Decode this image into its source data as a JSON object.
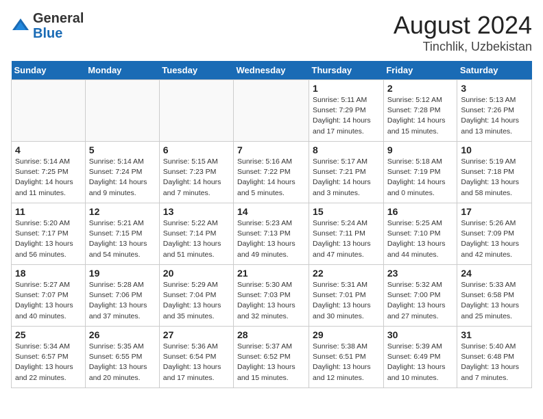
{
  "header": {
    "logo_general": "General",
    "logo_blue": "Blue",
    "month_year": "August 2024",
    "location": "Tinchlik, Uzbekistan"
  },
  "calendar": {
    "weekdays": [
      "Sunday",
      "Monday",
      "Tuesday",
      "Wednesday",
      "Thursday",
      "Friday",
      "Saturday"
    ],
    "weeks": [
      [
        {
          "day": "",
          "info": ""
        },
        {
          "day": "",
          "info": ""
        },
        {
          "day": "",
          "info": ""
        },
        {
          "day": "",
          "info": ""
        },
        {
          "day": "1",
          "info": "Sunrise: 5:11 AM\nSunset: 7:29 PM\nDaylight: 14 hours and 17 minutes."
        },
        {
          "day": "2",
          "info": "Sunrise: 5:12 AM\nSunset: 7:28 PM\nDaylight: 14 hours and 15 minutes."
        },
        {
          "day": "3",
          "info": "Sunrise: 5:13 AM\nSunset: 7:26 PM\nDaylight: 14 hours and 13 minutes."
        }
      ],
      [
        {
          "day": "4",
          "info": "Sunrise: 5:14 AM\nSunset: 7:25 PM\nDaylight: 14 hours and 11 minutes."
        },
        {
          "day": "5",
          "info": "Sunrise: 5:14 AM\nSunset: 7:24 PM\nDaylight: 14 hours and 9 minutes."
        },
        {
          "day": "6",
          "info": "Sunrise: 5:15 AM\nSunset: 7:23 PM\nDaylight: 14 hours and 7 minutes."
        },
        {
          "day": "7",
          "info": "Sunrise: 5:16 AM\nSunset: 7:22 PM\nDaylight: 14 hours and 5 minutes."
        },
        {
          "day": "8",
          "info": "Sunrise: 5:17 AM\nSunset: 7:21 PM\nDaylight: 14 hours and 3 minutes."
        },
        {
          "day": "9",
          "info": "Sunrise: 5:18 AM\nSunset: 7:19 PM\nDaylight: 14 hours and 0 minutes."
        },
        {
          "day": "10",
          "info": "Sunrise: 5:19 AM\nSunset: 7:18 PM\nDaylight: 13 hours and 58 minutes."
        }
      ],
      [
        {
          "day": "11",
          "info": "Sunrise: 5:20 AM\nSunset: 7:17 PM\nDaylight: 13 hours and 56 minutes."
        },
        {
          "day": "12",
          "info": "Sunrise: 5:21 AM\nSunset: 7:15 PM\nDaylight: 13 hours and 54 minutes."
        },
        {
          "day": "13",
          "info": "Sunrise: 5:22 AM\nSunset: 7:14 PM\nDaylight: 13 hours and 51 minutes."
        },
        {
          "day": "14",
          "info": "Sunrise: 5:23 AM\nSunset: 7:13 PM\nDaylight: 13 hours and 49 minutes."
        },
        {
          "day": "15",
          "info": "Sunrise: 5:24 AM\nSunset: 7:11 PM\nDaylight: 13 hours and 47 minutes."
        },
        {
          "day": "16",
          "info": "Sunrise: 5:25 AM\nSunset: 7:10 PM\nDaylight: 13 hours and 44 minutes."
        },
        {
          "day": "17",
          "info": "Sunrise: 5:26 AM\nSunset: 7:09 PM\nDaylight: 13 hours and 42 minutes."
        }
      ],
      [
        {
          "day": "18",
          "info": "Sunrise: 5:27 AM\nSunset: 7:07 PM\nDaylight: 13 hours and 40 minutes."
        },
        {
          "day": "19",
          "info": "Sunrise: 5:28 AM\nSunset: 7:06 PM\nDaylight: 13 hours and 37 minutes."
        },
        {
          "day": "20",
          "info": "Sunrise: 5:29 AM\nSunset: 7:04 PM\nDaylight: 13 hours and 35 minutes."
        },
        {
          "day": "21",
          "info": "Sunrise: 5:30 AM\nSunset: 7:03 PM\nDaylight: 13 hours and 32 minutes."
        },
        {
          "day": "22",
          "info": "Sunrise: 5:31 AM\nSunset: 7:01 PM\nDaylight: 13 hours and 30 minutes."
        },
        {
          "day": "23",
          "info": "Sunrise: 5:32 AM\nSunset: 7:00 PM\nDaylight: 13 hours and 27 minutes."
        },
        {
          "day": "24",
          "info": "Sunrise: 5:33 AM\nSunset: 6:58 PM\nDaylight: 13 hours and 25 minutes."
        }
      ],
      [
        {
          "day": "25",
          "info": "Sunrise: 5:34 AM\nSunset: 6:57 PM\nDaylight: 13 hours and 22 minutes."
        },
        {
          "day": "26",
          "info": "Sunrise: 5:35 AM\nSunset: 6:55 PM\nDaylight: 13 hours and 20 minutes."
        },
        {
          "day": "27",
          "info": "Sunrise: 5:36 AM\nSunset: 6:54 PM\nDaylight: 13 hours and 17 minutes."
        },
        {
          "day": "28",
          "info": "Sunrise: 5:37 AM\nSunset: 6:52 PM\nDaylight: 13 hours and 15 minutes."
        },
        {
          "day": "29",
          "info": "Sunrise: 5:38 AM\nSunset: 6:51 PM\nDaylight: 13 hours and 12 minutes."
        },
        {
          "day": "30",
          "info": "Sunrise: 5:39 AM\nSunset: 6:49 PM\nDaylight: 13 hours and 10 minutes."
        },
        {
          "day": "31",
          "info": "Sunrise: 5:40 AM\nSunset: 6:48 PM\nDaylight: 13 hours and 7 minutes."
        }
      ]
    ]
  }
}
